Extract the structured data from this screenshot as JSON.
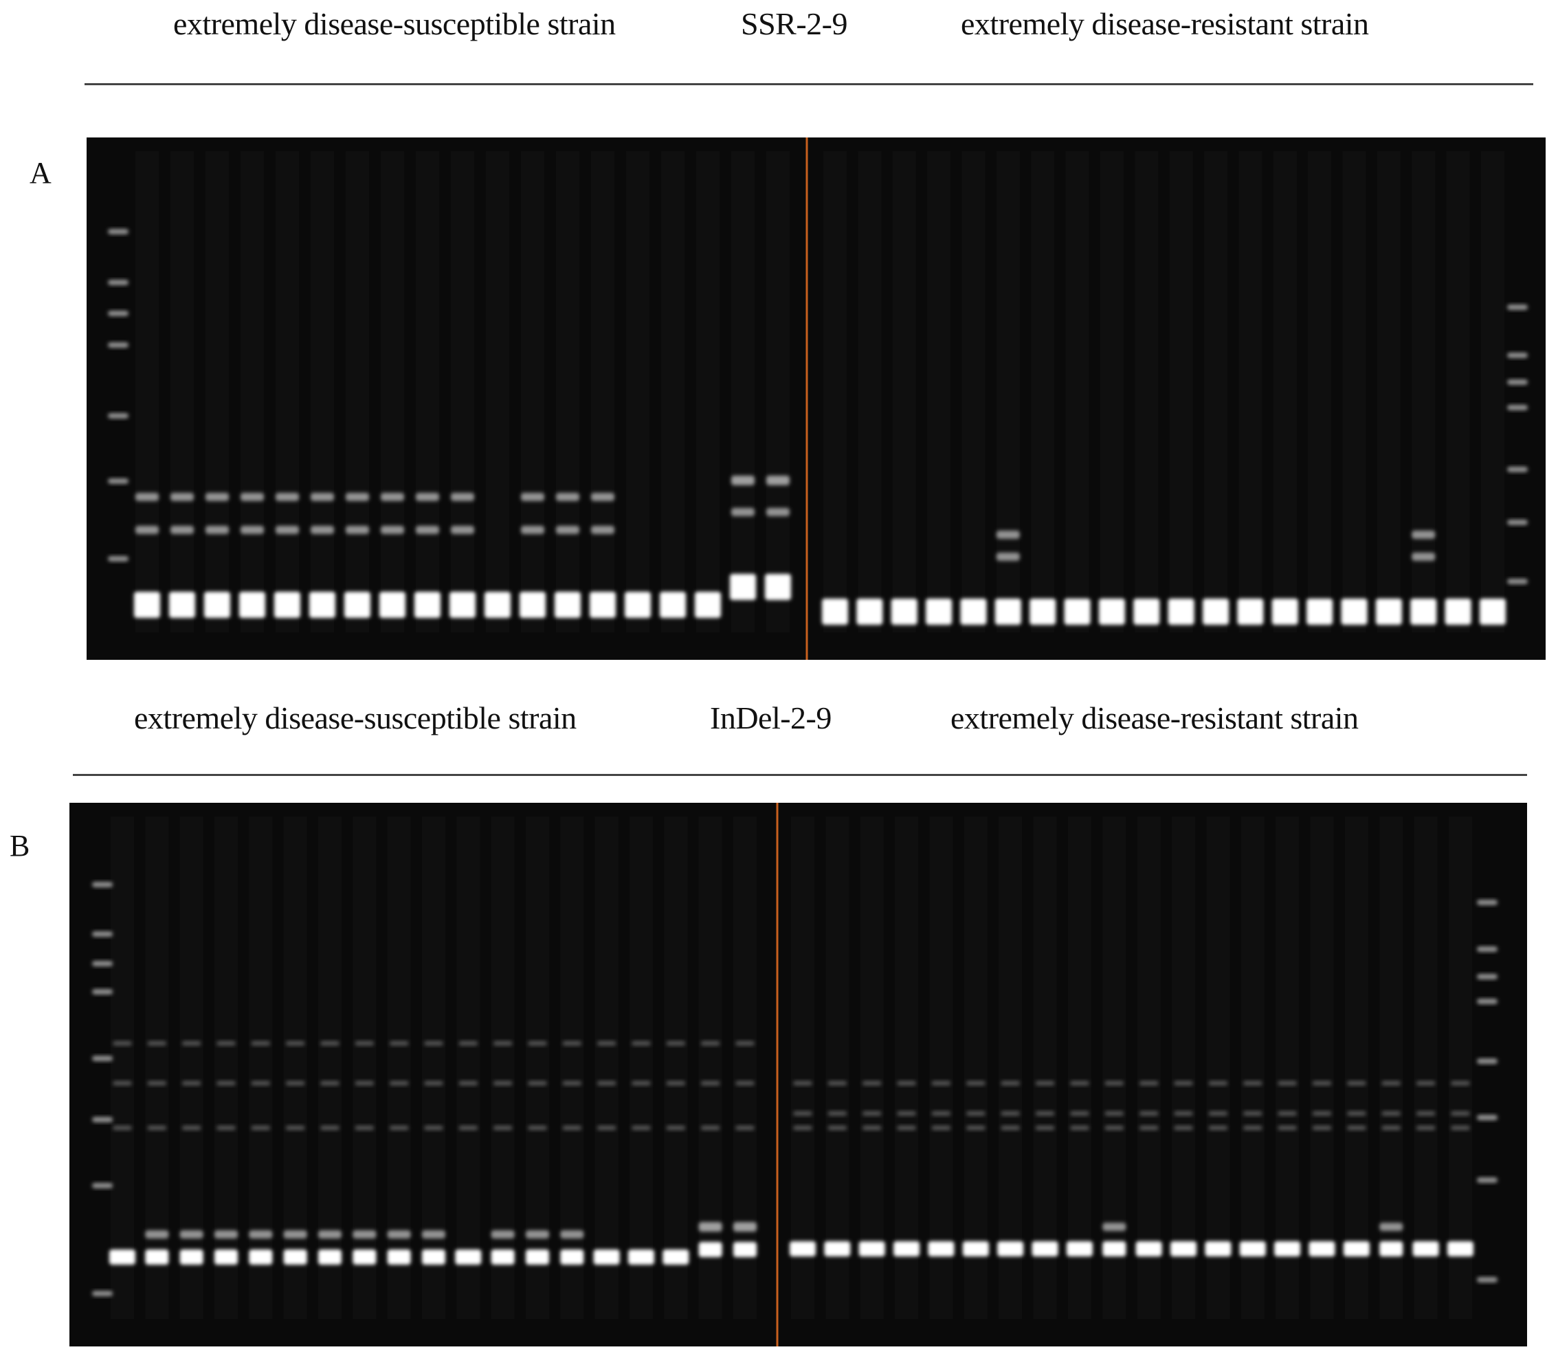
{
  "panels": [
    {
      "letter": "A",
      "marker_name": "SSR-2-9",
      "left_group": "extremely disease-susceptible strain",
      "right_group": "extremely disease-resistant strain",
      "left_lanes": [
        "H",
        "H",
        "H",
        "H",
        "H",
        "H",
        "H",
        "H",
        "H",
        "H",
        "S",
        "H",
        "H",
        "H",
        "S",
        "S",
        "S",
        "H2",
        "H2"
      ],
      "right_lanes": [
        "S",
        "S",
        "S",
        "S",
        "S",
        "H",
        "S",
        "S",
        "S",
        "S",
        "S",
        "S",
        "S",
        "S",
        "S",
        "S",
        "S",
        "H",
        "S",
        "S"
      ],
      "divider_color": "#c8601e"
    },
    {
      "letter": "B",
      "marker_name": "InDel-2-9",
      "left_group": "extremely disease-susceptible strain",
      "right_group": "extremely disease-resistant strain",
      "left_lanes": [
        "S",
        "H",
        "H",
        "H",
        "H",
        "H",
        "H",
        "H",
        "H",
        "H",
        "S",
        "H",
        "H",
        "H",
        "S",
        "S",
        "S",
        "H2",
        "H2"
      ],
      "right_lanes": [
        "S",
        "S",
        "S",
        "S",
        "S",
        "S",
        "S",
        "S",
        "S",
        "H",
        "S",
        "S",
        "S",
        "S",
        "S",
        "S",
        "S",
        "H",
        "S",
        "S"
      ],
      "divider_color": "#c8601e"
    }
  ]
}
